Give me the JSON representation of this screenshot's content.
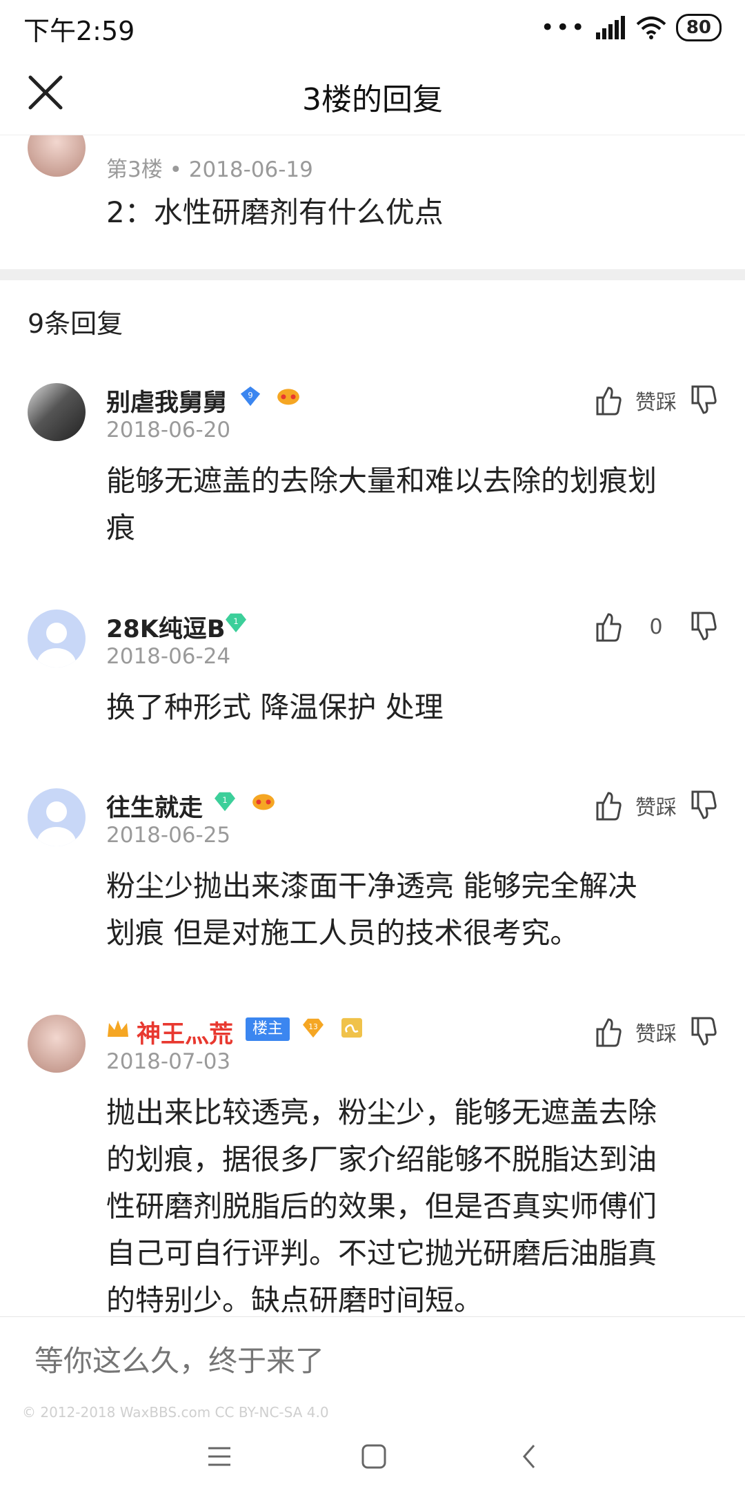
{
  "status": {
    "time": "下午2:59",
    "battery": "80"
  },
  "header": {
    "title": "3楼的回复"
  },
  "post": {
    "floor_meta": "第3楼 • 2018-06-19",
    "content": "2：水性研磨剂有什么优点"
  },
  "replies_label": "9条回复",
  "vote_label": "赞踩",
  "comments": [
    {
      "name": "别虐我舅舅",
      "level": "9",
      "date": "2018-06-20",
      "vote": "赞踩",
      "text": [
        "能够无遮盖的去除大量和难以去除的划痕划",
        "痕"
      ]
    },
    {
      "name": "28K纯逗B",
      "level": "1",
      "date": "2018-06-24",
      "vote": "0",
      "text": [
        "换了种形式 降温保护 处理"
      ]
    },
    {
      "name": "往生就走",
      "level": "1",
      "date": "2018-06-25",
      "vote": "赞踩",
      "text": [
        "粉尘少抛出来漆面干净透亮 能够完全解决",
        "划痕 但是对施工人员的技术很考究。"
      ]
    },
    {
      "name": "神王灬荒",
      "role": "楼主",
      "level": "13",
      "date": "2018-07-03",
      "vote": "赞踩",
      "text": [
        "抛出来比较透亮，粉尘少，能够无遮盖去除",
        "的划痕，据很多厂家介绍能够不脱脂达到油",
        "性研磨剂脱脂后的效果，但是否真实师傅们",
        "自己可自行评判。不过它抛光研磨后油脂真",
        "的特别少。缺点研磨时间短。"
      ]
    }
  ],
  "input": {
    "placeholder": "等你这么久，终于来了"
  },
  "footer": {
    "copyright": "© 2012-2018 WaxBBS.com CC BY-NC-SA 4.0"
  },
  "colors": {
    "accent_red": "#e8382f",
    "badge_blue": "#3b86f0",
    "diamond_green": "#3ccf9a",
    "level_orange": "#f5a623"
  }
}
